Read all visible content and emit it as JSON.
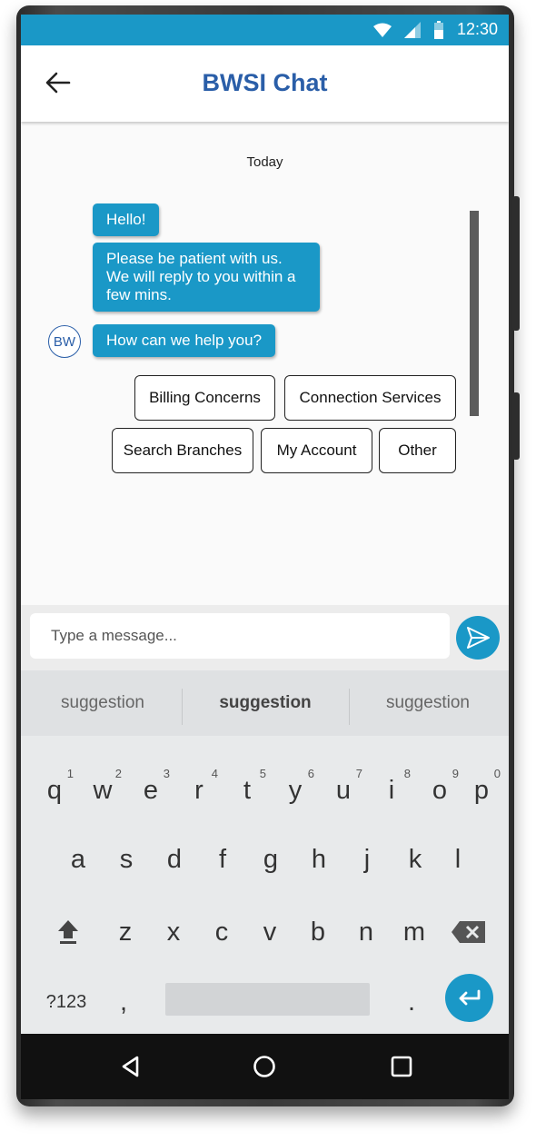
{
  "status": {
    "time": "12:30",
    "icons": [
      "wifi-icon",
      "signal-icon",
      "battery-icon"
    ]
  },
  "header": {
    "title": "BWSI Chat"
  },
  "chat": {
    "date_label": "Today",
    "messages": [
      "Hello!",
      "Please be patient with us.\nWe will reply to you within a\nfew mins.",
      "How can we help you?"
    ],
    "avatar_text": "BW"
  },
  "quick_replies": [
    "Billing Concerns",
    "Connection Services",
    "Search Branches",
    "My Account",
    "Other"
  ],
  "composer": {
    "placeholder": "Type a message..."
  },
  "keyboard": {
    "suggestions": [
      "suggestion",
      "suggestion",
      "suggestion"
    ],
    "row1": [
      "q",
      "w",
      "e",
      "r",
      "t",
      "y",
      "u",
      "i",
      "o",
      "p"
    ],
    "row1_hints": [
      "1",
      "2",
      "3",
      "4",
      "5",
      "6",
      "7",
      "8",
      "9",
      "0"
    ],
    "row2": [
      "a",
      "s",
      "d",
      "f",
      "g",
      "h",
      "j",
      "k",
      "l"
    ],
    "row3": [
      "z",
      "x",
      "c",
      "v",
      "b",
      "n",
      "m"
    ],
    "symbols_label": "?123",
    "comma": ",",
    "period": "."
  },
  "colors": {
    "accent": "#1a98c7",
    "title": "#2a5ea8",
    "navbar": "#111111"
  }
}
